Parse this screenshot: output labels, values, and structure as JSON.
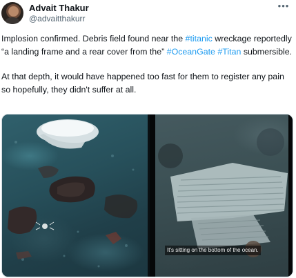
{
  "author": {
    "name": "Advait Thakur",
    "handle": "@advaitthakurr"
  },
  "more_icon": "more-horizontal-icon",
  "tweet": {
    "p1_a": "Implosion confirmed. Debris field found near the ",
    "tag_titanic": "#titanic",
    "p1_b": " wreckage reportedly “a landing frame and a rear cover from the” ",
    "tag_oceangate": "#OceanGate",
    "tag_titan": "#Titan",
    "p1_c": " submersible.",
    "p2": "At that depth, it would have happened too fast for them to register any pain so hopefully, they didn't suffer at all."
  },
  "media": {
    "caption": "It's sitting on the bottom of the ocean."
  },
  "colors": {
    "link": "#1d9bf0",
    "text": "#0f1419",
    "secondary": "#536471"
  }
}
